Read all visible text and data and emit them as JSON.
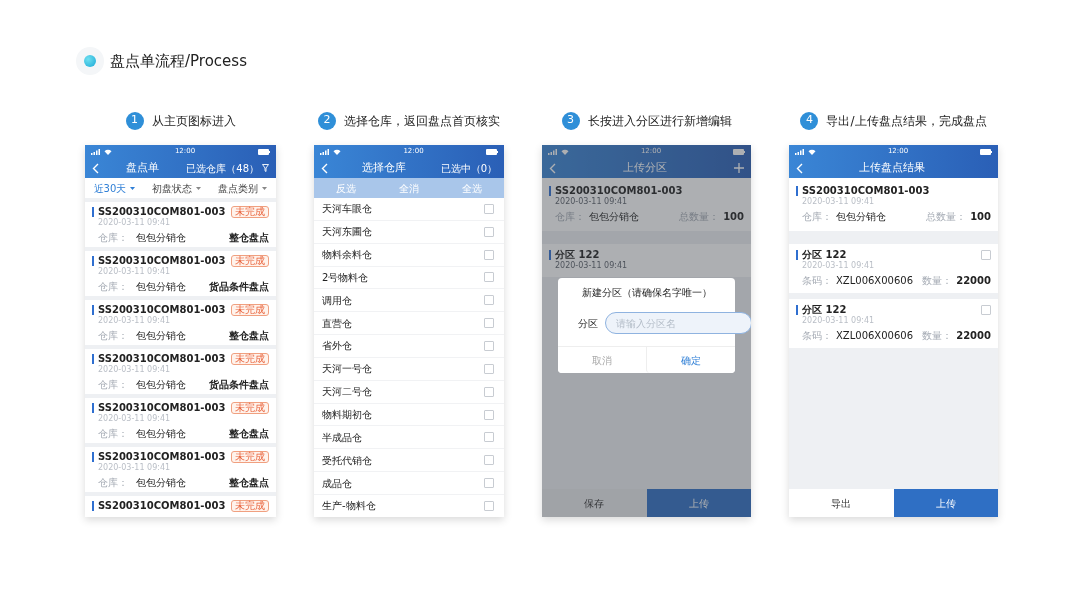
{
  "page": {
    "title": "盘点单流程/Process"
  },
  "steps": [
    {
      "number": "1",
      "caption": "从主页图标进入",
      "screen": {
        "kind": "order-list",
        "time": "12:00",
        "nav": {
          "title": "盘点单",
          "right": "已选仓库（48）"
        },
        "filters": [
          {
            "label": "近30天",
            "selected": true
          },
          {
            "label": "初盘状态",
            "selected": false
          },
          {
            "label": "盘点类别",
            "selected": false
          }
        ],
        "cards": [
          {
            "code": "SS200310COM801-003",
            "time": "2020-03-11 09:41",
            "label": "仓库：",
            "warehouse": "包包分销仓",
            "badge": "未完成",
            "type": "整仓盘点"
          },
          {
            "code": "SS200310COM801-003",
            "time": "2020-03-11 09:41",
            "label": "仓库：",
            "warehouse": "包包分销仓",
            "badge": "未完成",
            "type": "货品条件盘点"
          },
          {
            "code": "SS200310COM801-003",
            "time": "2020-03-11 09:41",
            "label": "仓库：",
            "warehouse": "包包分销仓",
            "badge": "未完成",
            "type": "整仓盘点"
          },
          {
            "code": "SS200310COM801-003",
            "time": "2020-03-11 09:41",
            "label": "仓库：",
            "warehouse": "包包分销仓",
            "badge": "未完成",
            "type": "货品条件盘点"
          },
          {
            "code": "SS200310COM801-003",
            "time": "2020-03-11 09:41",
            "label": "仓库：",
            "warehouse": "包包分销仓",
            "badge": "未完成",
            "type": "整仓盘点"
          },
          {
            "code": "SS200310COM801-003",
            "time": "2020-03-11 09:41",
            "label": "仓库：",
            "warehouse": "包包分销仓",
            "badge": "未完成",
            "type": "整仓盘点"
          },
          {
            "code": "SS200310COM801-003",
            "badge": "未完成"
          }
        ]
      }
    },
    {
      "number": "2",
      "caption": "选择仓库，返回盘点首页核实",
      "screen": {
        "kind": "warehouse-picker",
        "time": "12:00",
        "nav": {
          "title": "选择仓库",
          "right": "已选中（0）"
        },
        "actions": [
          "反选",
          "全消",
          "全选"
        ],
        "items": [
          {
            "name": "天河车眼仓",
            "checked": false
          },
          {
            "name": "天河东圃仓",
            "checked": false
          },
          {
            "name": "物料余料仓",
            "checked": false
          },
          {
            "name": "2号物料仓",
            "checked": false
          },
          {
            "name": "调用仓",
            "checked": false
          },
          {
            "name": "直营仓",
            "checked": false
          },
          {
            "name": "省外仓",
            "checked": false
          },
          {
            "name": "天河一号仓",
            "checked": false
          },
          {
            "name": "天河二号仓",
            "checked": false
          },
          {
            "name": "物料期初仓",
            "checked": false
          },
          {
            "name": "半成品仓",
            "checked": false
          },
          {
            "name": "受托代销仓",
            "checked": false
          },
          {
            "name": "成品仓",
            "checked": false
          },
          {
            "name": "生产-物料仓",
            "checked": false
          }
        ]
      }
    },
    {
      "number": "3",
      "caption": "长按进入分区进行新增编辑",
      "screen": {
        "kind": "partition-editor",
        "time": "12:00",
        "nav": {
          "title": "上传分区"
        },
        "header": {
          "code": "SS200310COM801-003",
          "time": "2020-03-11 09:41",
          "fields": [
            {
              "label": "仓库：",
              "value": "包包分销仓"
            },
            {
              "label": "总数量：",
              "value": "100"
            }
          ]
        },
        "partitions": [
          {
            "name": "分区 122",
            "time": "2020-03-11 09:41"
          }
        ],
        "dialog": {
          "title": "新建分区（请确保名字唯一）",
          "field_label": "分区",
          "placeholder": "请输入分区名",
          "buttons": [
            {
              "label": "取消",
              "kind": "cancel"
            },
            {
              "label": "确定",
              "kind": "confirm"
            }
          ]
        },
        "buttons": [
          {
            "label": "保存",
            "kind": "secondary"
          },
          {
            "label": "上传",
            "kind": "primary"
          }
        ]
      }
    },
    {
      "number": "4",
      "caption": "导出/上传盘点结果，完成盘点",
      "screen": {
        "kind": "upload-result",
        "time": "12:00",
        "nav": {
          "title": "上传盘点结果"
        },
        "header": {
          "code": "SS200310COM801-003",
          "time": "2020-03-11 09:41",
          "fields": [
            {
              "label": "仓库：",
              "value": "包包分销仓"
            },
            {
              "label": "总数量：",
              "value": "100"
            }
          ]
        },
        "partitions": [
          {
            "name": "分区 122",
            "time": "2020-03-11 09:41",
            "checked": false,
            "fields": [
              {
                "label": "条码：",
                "value": "XZL006X00606"
              },
              {
                "label": "数量：",
                "value": "22000"
              }
            ]
          },
          {
            "name": "分区 122",
            "time": "2020-03-11 09:41",
            "checked": false,
            "fields": [
              {
                "label": "条码：",
                "value": "XZL006X00606"
              },
              {
                "label": "数量：",
                "value": "22000"
              }
            ]
          }
        ],
        "buttons": [
          {
            "label": "导出",
            "kind": "secondary-light"
          },
          {
            "label": "上传",
            "kind": "primary"
          }
        ]
      }
    }
  ]
}
